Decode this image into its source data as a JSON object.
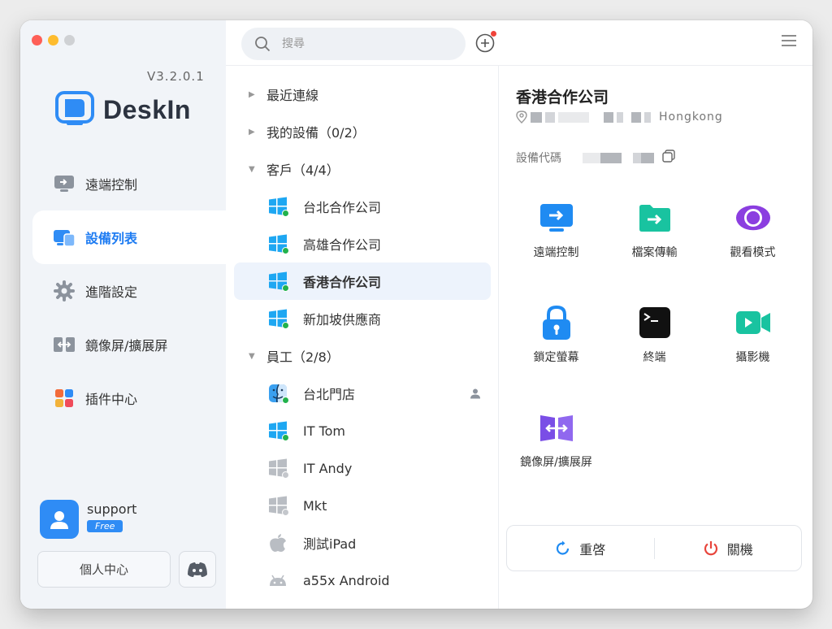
{
  "app": {
    "version": "V3.2.0.1",
    "brand": "DeskIn",
    "accent_color": "#1e7cf2"
  },
  "sidebar": {
    "items": [
      {
        "label": "遠端控制",
        "icon": "remote-desktop-icon"
      },
      {
        "label": "設備列表",
        "icon": "device-list-icon",
        "active": true
      },
      {
        "label": "進階設定",
        "icon": "gear-icon"
      },
      {
        "label": "鏡像屏/擴展屏",
        "icon": "mirror-screen-icon"
      },
      {
        "label": "插件中心",
        "icon": "plugin-grid-icon"
      }
    ],
    "user": {
      "name": "support",
      "plan": "Free"
    },
    "personal_center": "個人中心",
    "discord_icon": "discord-icon"
  },
  "search": {
    "placeholder": "搜尋"
  },
  "groups": [
    {
      "label": "最近連線",
      "expanded": false
    },
    {
      "label": "我的設備（0/2）",
      "expanded": false
    },
    {
      "label": "客戶（4/4）",
      "expanded": true,
      "devices": [
        {
          "name": "台北合作公司",
          "os": "windows",
          "online": true
        },
        {
          "name": "高雄合作公司",
          "os": "windows",
          "online": true
        },
        {
          "name": "香港合作公司",
          "os": "windows",
          "online": true,
          "selected": true
        },
        {
          "name": "新加坡供應商",
          "os": "windows",
          "online": true
        }
      ]
    },
    {
      "label": "員工（2/8）",
      "expanded": true,
      "devices": [
        {
          "name": "台北門店",
          "os": "macos",
          "online": true
        },
        {
          "name": "IT Tom",
          "os": "windows",
          "online": true
        },
        {
          "name": "IT Andy",
          "os": "windows",
          "online": false
        },
        {
          "name": "Mkt",
          "os": "windows",
          "online": false
        },
        {
          "name": "測試iPad",
          "os": "apple",
          "online": false
        },
        {
          "name": "a55x Android",
          "os": "android",
          "online": false
        }
      ]
    }
  ],
  "detail": {
    "title": "香港合作公司",
    "location": "Hongkong",
    "code_label": "設備代碼",
    "actions": [
      {
        "label": "遠端控制",
        "icon": "remote-control-icon"
      },
      {
        "label": "檔案傳輸",
        "icon": "file-transfer-icon"
      },
      {
        "label": "觀看模式",
        "icon": "view-mode-icon"
      },
      {
        "label": "鎖定螢幕",
        "icon": "lock-screen-icon"
      },
      {
        "label": "終端",
        "icon": "terminal-icon"
      },
      {
        "label": "攝影機",
        "icon": "camera-icon"
      },
      {
        "label": "鏡像屏/擴展屏",
        "icon": "mirror-extend-icon"
      }
    ],
    "restart_label": "重啓",
    "shutdown_label": "關機"
  }
}
